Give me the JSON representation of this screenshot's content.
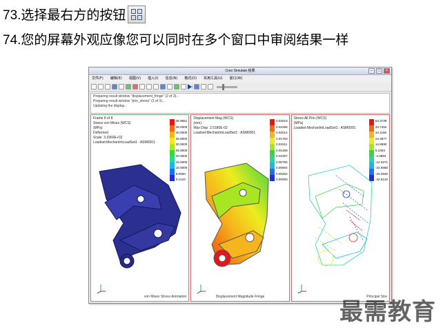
{
  "steps": [
    {
      "number": "73.",
      "text": "选择最右方的按钮"
    },
    {
      "number": "74.",
      "text": "您的屏幕外观应像您可以同时在多个窗口中审阅结果一样"
    }
  ],
  "window": {
    "title": "Creo Simulate 结果",
    "menu": [
      "文件(F)",
      "编辑(E)",
      "视图(V)",
      "插入(I)",
      "信息(N)",
      "格式(O)",
      "实用工具(U)",
      "窗口(W)"
    ],
    "messages": [
      "Preparing result window \"displacement_fringe\" (2 of 3)...",
      "Preparing result window \"prin_stress\" (3 of 3)...",
      "Updating the display..."
    ]
  },
  "panes": [
    {
      "info": "Frame 8 of 8\nStress von Mises (WCS)\n(MPa)\nDeformed\nScale  3.3369E+02\nLoadset:MechanImLoadSet1 : ASM0001",
      "title": "von Mises Stress Animation",
      "legend": [
        "45.9651",
        "45.0000",
        "40.0000",
        "35.0000",
        "30.0000",
        "25.0000",
        "20.0000",
        "15.0000",
        "10.0000",
        "5.0000",
        "0.1443"
      ],
      "colors": [
        "#e8141a",
        "#f26a12",
        "#f6b51c",
        "#ecec20",
        "#a8e622",
        "#3fd43f",
        "#22d8a6",
        "#1fb5e8",
        "#1f6ff0",
        "#1c2fd8",
        "#1a1aa0"
      ]
    },
    {
      "info": "Displacement Mag (WCS)\n(mm)\nMax Disp  2.5180E-02\nLoadset:MechanImLoadSet1 : ASM0001",
      "title": "Displacement Magnitude Fringe",
      "legend": [
        "0.02518",
        "0.02266",
        "0.02014",
        "0.01763",
        "0.01511",
        "0.01259",
        "0.01007",
        "0.00755",
        "0.00504",
        "0.00252",
        "0.00000"
      ],
      "colors": [
        "#e8141a",
        "#f26a12",
        "#f6b51c",
        "#ecec20",
        "#a8e622",
        "#3fd43f",
        "#22d8a6",
        "#1fb5e8",
        "#1f6ff0",
        "#1c2fd8",
        "#1a1aa0"
      ]
    },
    {
      "info": "Stress All Prin (WCS)\n(MPa)\nLoadset:MechanImLoadSet1 : ASM0001",
      "title": "Principal Stre",
      "legend": [
        "53.3739",
        "43.7452",
        "34.1165",
        "24.4877",
        "14.8590",
        "5.2303",
        "-4.3984",
        "-14.0271",
        "-23.6558",
        "-33.2846",
        "-42.9133"
      ],
      "colors": [
        "#e8141a",
        "#f26a12",
        "#f6b51c",
        "#ecec20",
        "#a8e622",
        "#3fd43f",
        "#22d8a6",
        "#1fb5e8",
        "#1f6ff0",
        "#1c2fd8",
        "#1a1aa0"
      ]
    }
  ],
  "watermark": "最需教育"
}
